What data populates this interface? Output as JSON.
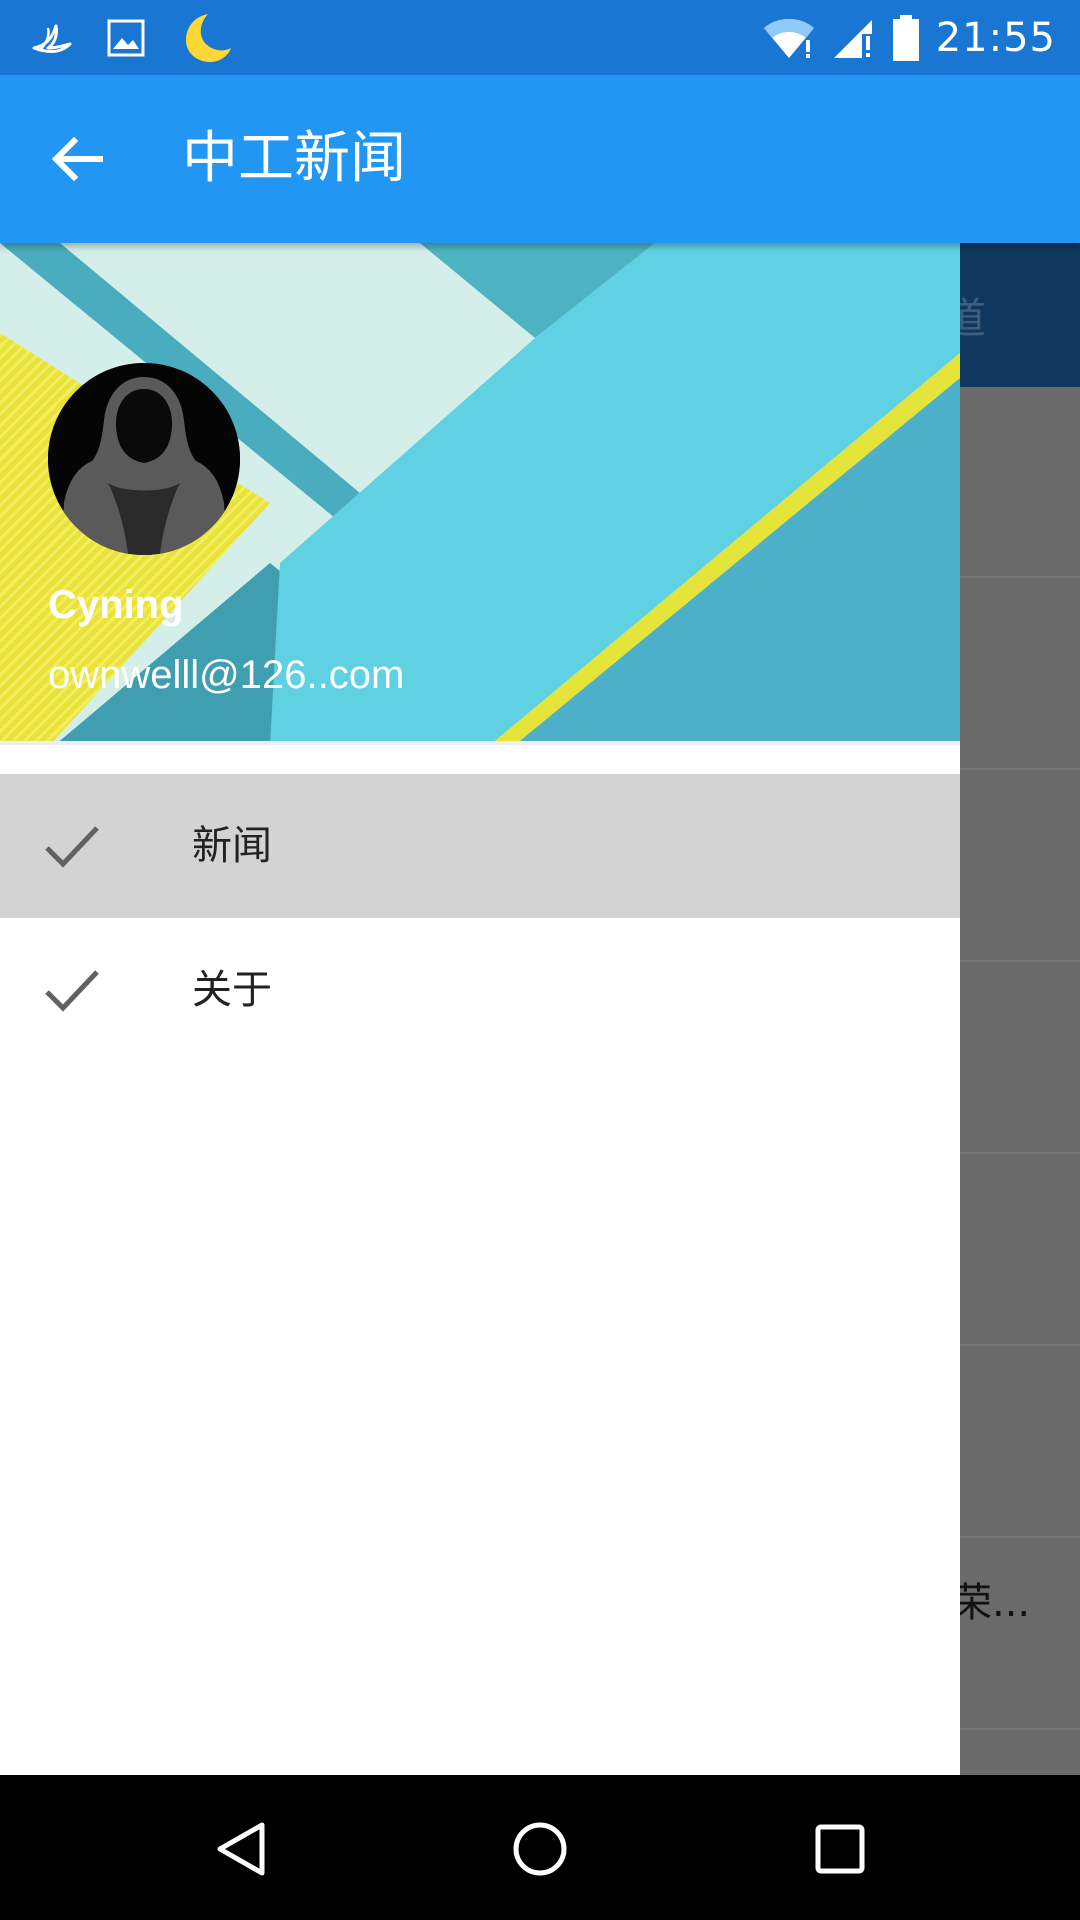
{
  "status_bar": {
    "time": "21:55",
    "left_icons": [
      "bird-app-icon",
      "gallery-icon",
      "moon-icon"
    ],
    "right_icons": [
      "wifi-icon",
      "signal-icon",
      "battery-icon"
    ]
  },
  "app_bar": {
    "title": "中工新闻",
    "back_icon": "arrow-left-icon"
  },
  "background_content": {
    "tab_text": "道",
    "snippet": "荣..."
  },
  "drawer": {
    "profile": {
      "name": "Cyning",
      "email": "ownwelll@126..com"
    },
    "menu": [
      {
        "label": "新闻",
        "icon": "check-icon",
        "selected": true
      },
      {
        "label": "关于",
        "icon": "check-icon",
        "selected": false
      }
    ]
  },
  "nav_bar": {
    "buttons": [
      "back-triangle-icon",
      "home-circle-icon",
      "recents-square-icon"
    ]
  },
  "colors": {
    "status_bar": "#1976d2",
    "app_bar": "#2196f3",
    "selected_item": "#d3d3d3",
    "scrim": "#6a6a6a"
  }
}
